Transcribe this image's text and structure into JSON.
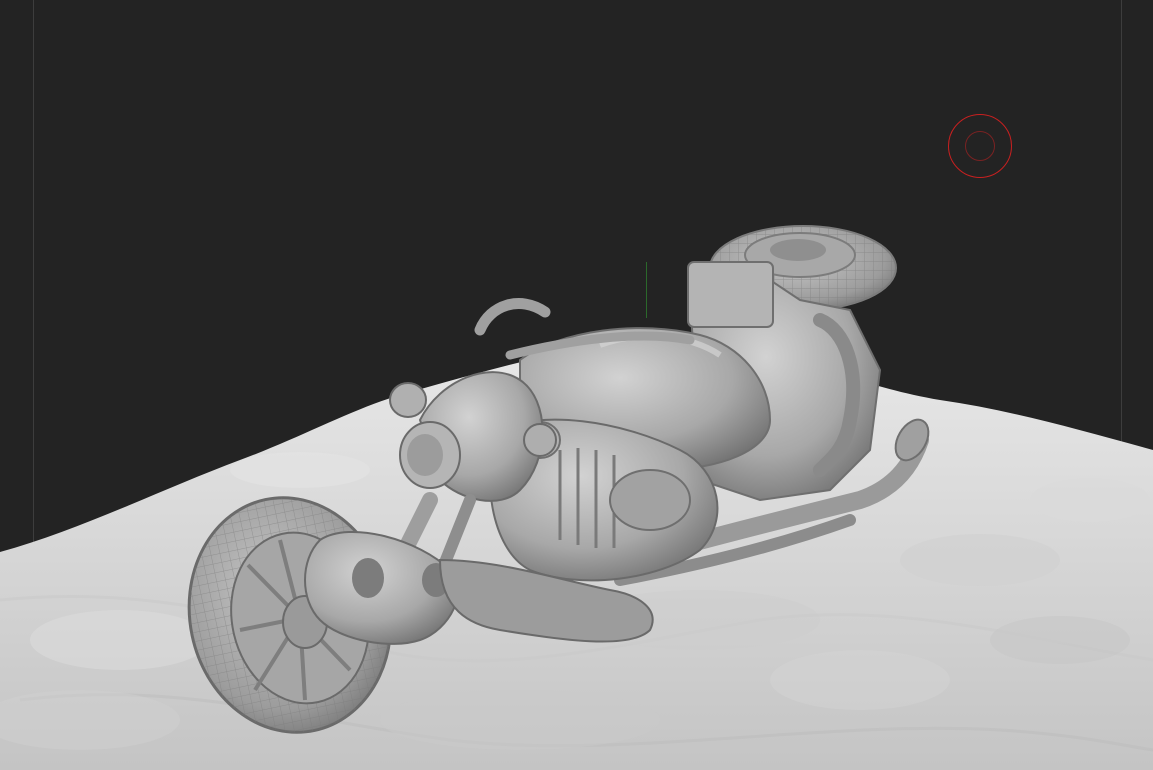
{
  "viewport": {
    "background_color": "#232323",
    "material_color": "#bdbdbd"
  },
  "model": {
    "subject": "motorcycle-sculpt",
    "terrain": "snow-terrain"
  },
  "cursor": {
    "icon": "brush-cursor-icon",
    "color": "#c82020"
  },
  "axis": {
    "icon": "vertical-axis-icon",
    "color": "#2d7a2d"
  }
}
